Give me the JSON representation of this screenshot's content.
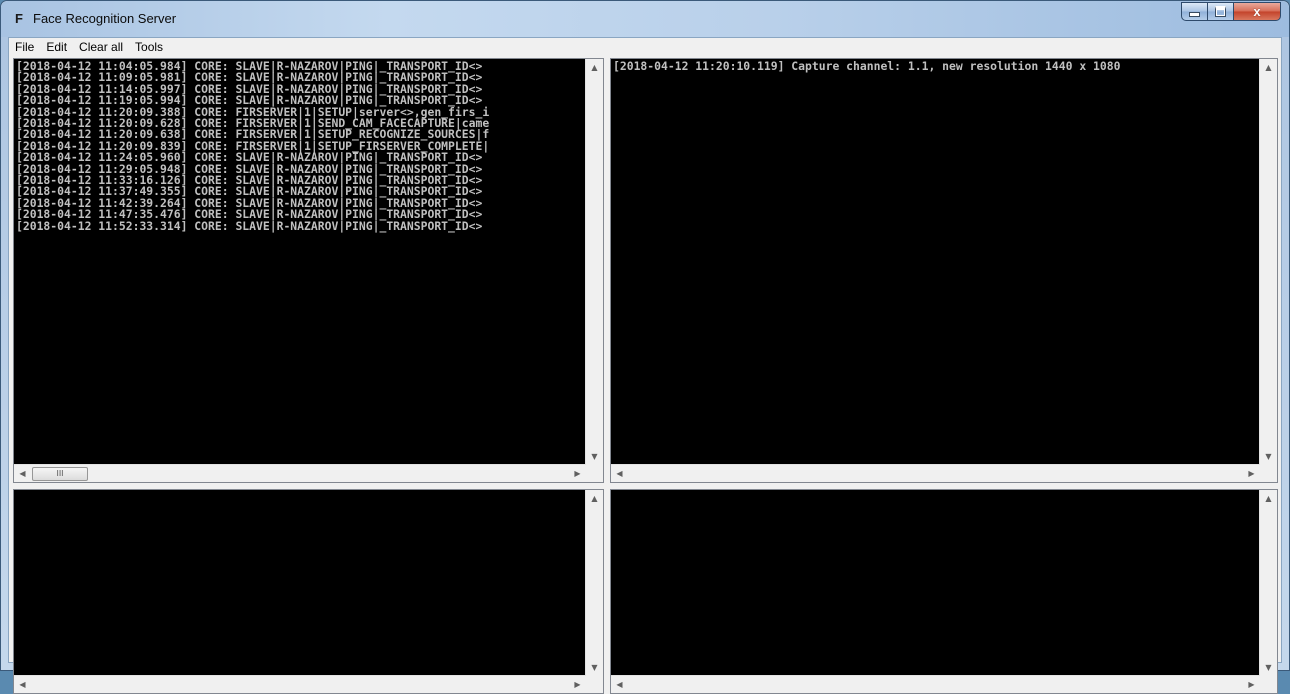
{
  "window": {
    "icon_letter": "F",
    "title": "Face Recognition Server"
  },
  "menu": {
    "items": [
      "File",
      "Edit",
      "Clear all",
      "Tools"
    ]
  },
  "panes": {
    "top_left": {
      "lines": [
        "[2018-04-12 11:04:05.984] CORE: SLAVE|R-NAZAROV|PING|_TRANSPORT_ID<>",
        "[2018-04-12 11:09:05.981] CORE: SLAVE|R-NAZAROV|PING|_TRANSPORT_ID<>",
        "[2018-04-12 11:14:05.997] CORE: SLAVE|R-NAZAROV|PING|_TRANSPORT_ID<>",
        "[2018-04-12 11:19:05.994] CORE: SLAVE|R-NAZAROV|PING|_TRANSPORT_ID<>",
        "[2018-04-12 11:20:09.388] CORE: FIRSERVER|1|SETUP|server<>,gen_firs_i",
        "[2018-04-12 11:20:09.628] CORE: FIRSERVER|1|SEND_CAM_FACECAPTURE|came",
        "[2018-04-12 11:20:09.638] CORE: FIRSERVER|1|SETUP_RECOGNIZE_SOURCES|f",
        "[2018-04-12 11:20:09.839] CORE: FIRSERVER|1|SETUP_FIRSERVER_COMPLETE|",
        "[2018-04-12 11:24:05.960] CORE: SLAVE|R-NAZAROV|PING|_TRANSPORT_ID<>",
        "[2018-04-12 11:29:05.948] CORE: SLAVE|R-NAZAROV|PING|_TRANSPORT_ID<>",
        "[2018-04-12 11:33:16.126] CORE: SLAVE|R-NAZAROV|PING|_TRANSPORT_ID<>",
        "[2018-04-12 11:37:49.355] CORE: SLAVE|R-NAZAROV|PING|_TRANSPORT_ID<>",
        "[2018-04-12 11:42:39.264] CORE: SLAVE|R-NAZAROV|PING|_TRANSPORT_ID<>",
        "[2018-04-12 11:47:35.476] CORE: SLAVE|R-NAZAROV|PING|_TRANSPORT_ID<>",
        "[2018-04-12 11:52:33.314] CORE: SLAVE|R-NAZAROV|PING|_TRANSPORT_ID<>"
      ],
      "hscroll_thumb_label": "III"
    },
    "top_right": {
      "lines": [
        "[2018-04-12 11:20:10.119] Capture channel: 1.1, new resolution 1440 x 1080"
      ]
    },
    "bottom_left": {
      "lines": []
    },
    "bottom_right": {
      "lines": []
    }
  },
  "scroll_glyphs": {
    "up": "▲",
    "down": "▼",
    "left": "◀",
    "right": "▶"
  },
  "caption_buttons": {
    "close_glyph": "x"
  }
}
